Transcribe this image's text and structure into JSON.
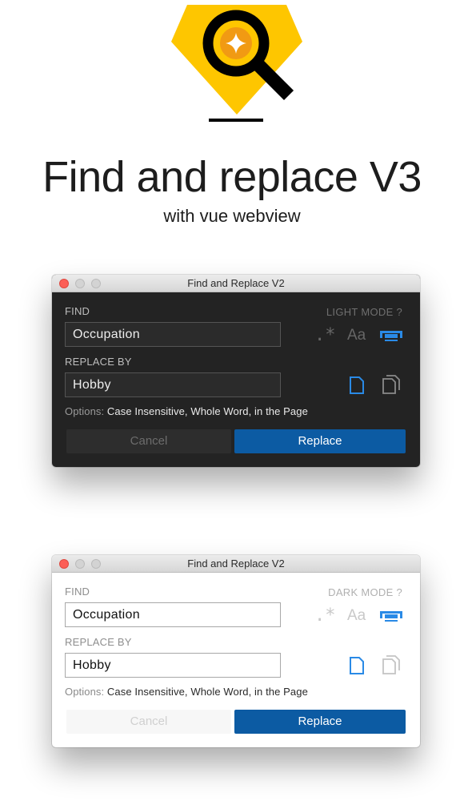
{
  "header": {
    "title": "Find and replace V3",
    "subtitle": "with vue webview"
  },
  "colors": {
    "accent_blue": "#0c5ba3",
    "icon_blue": "#2a8ae6",
    "logo_yellow": "#fec600"
  },
  "dark_window": {
    "window_title": "Find and Replace V2",
    "find_label": "FIND",
    "mode_toggle": "LIGHT MODE  ?",
    "find_value": "Occupation",
    "replace_label": "REPLACE BY",
    "replace_value": "Hobby",
    "regex_icon": ".*",
    "case_icon": "Aa",
    "options_prefix": "Options:",
    "options_text": " Case Insensitive, Whole Word, in the Page",
    "cancel_label": "Cancel",
    "replace_button_label": "Replace"
  },
  "light_window": {
    "window_title": "Find and Replace V2",
    "find_label": "FIND",
    "mode_toggle": "DARK MODE  ?",
    "find_value": "Occupation",
    "replace_label": "REPLACE BY",
    "replace_value": "Hobby",
    "regex_icon": ".*",
    "case_icon": "Aa",
    "options_prefix": "Options:",
    "options_text": " Case Insensitive, Whole Word, in the Page",
    "cancel_label": "Cancel",
    "replace_button_label": "Replace"
  },
  "icons": [
    "magnifier-logo-icon",
    "regex-icon",
    "match-case-icon",
    "whole-word-icon",
    "current-page-icon",
    "all-pages-icon"
  ]
}
